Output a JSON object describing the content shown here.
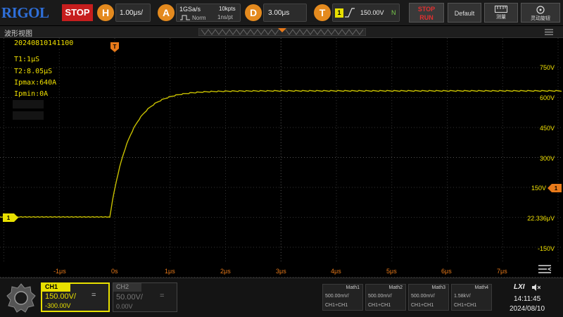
{
  "toolbar": {
    "logo": "RIGOL",
    "run_state": "STOP",
    "horizontal": {
      "icon_letter": "H",
      "timebase": "1.00μs/"
    },
    "acquire": {
      "icon_letter": "A",
      "sample_rate": "1GSa/s",
      "mode": "Norm",
      "points": "10kpts",
      "per_pt": "1ns/pt"
    },
    "delay": {
      "icon_letter": "D",
      "value": "3.00μs"
    },
    "trigger": {
      "icon_letter": "T",
      "source": "1",
      "level": "150.00V",
      "coupling": "N"
    },
    "stop_run_label_1": "STOP",
    "stop_run_label_2": "RUN",
    "default_label": "Default",
    "measure_label": "测量",
    "knob_label": "灵动旋钮"
  },
  "waveform": {
    "title": "波形视图",
    "timestamp": "20240810141100",
    "annotations": [
      "T1:1μS",
      "T2:8.05μS",
      "Ipmax:640A",
      "Ipmin:0A"
    ],
    "ch1_marker": "1",
    "trigger_marker": "T",
    "v_labels": [
      "750V",
      "600V",
      "450V",
      "300V",
      "150V",
      "22.336μV",
      "-150V"
    ],
    "t_labels": [
      "-1μs",
      "0s",
      "1μs",
      "2μs",
      "3μs",
      "4μs",
      "5μs",
      "6μs",
      "7μs"
    ]
  },
  "channels": {
    "ch1": {
      "name": "CH1",
      "scale": "150.00V/",
      "offset": "-300.00V",
      "coupling_icon": "="
    },
    "ch2": {
      "name": "CH2",
      "scale": "50.00V/",
      "offset": "0.00V",
      "coupling_icon": "="
    }
  },
  "math": [
    {
      "name": "Math1",
      "scale": "500.00mV/",
      "expr": "CH1+CH1"
    },
    {
      "name": "Math2",
      "scale": "500.00mV/",
      "expr": "CH1+CH1"
    },
    {
      "name": "Math3",
      "scale": "500.00mV/",
      "expr": "CH1+CH1"
    },
    {
      "name": "Math4",
      "scale": "1.58kV/",
      "expr": "CH1+CH1"
    }
  ],
  "status": {
    "lxi": "LXI",
    "time": "14:11:45",
    "date": "2024/08/10"
  },
  "colors": {
    "ch1": "#e8e000",
    "trigger": "#e87a1a",
    "stop": "#c61e1e",
    "grid": "#3a3a3a"
  }
}
